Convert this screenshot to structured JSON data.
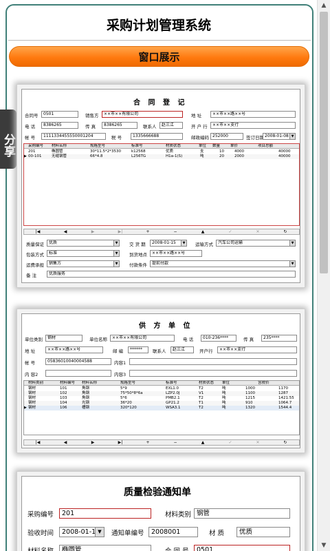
{
  "header": {
    "title": "采购计划管理系统",
    "banner": "窗口展示"
  },
  "share_tab": "分享",
  "contract": {
    "title": "合 同 登 记",
    "fields": {
      "contract_no_label": "合同号",
      "contract_no": "0501",
      "seller_label": "销售方",
      "seller": "××市××有限公司",
      "address_label": "地 址",
      "address": "××市××路××号",
      "phone_label": "电 话",
      "phone": "8386265",
      "fax_label": "传 真",
      "fax": "8386265",
      "contact_label": "联系人",
      "contact": "赵三江",
      "bank_label": "开 户 行",
      "bank": "××市××支行",
      "account_label": "帐 号",
      "account": "1111334455550001204",
      "tax_label": "税 号",
      "tax": "1335666688",
      "postcode_label": "邮政编码",
      "postcode": "252000",
      "sign_date_label": "签订日期",
      "sign_date": "2008-01-08"
    },
    "grid": {
      "headers": [
        "采购编号",
        "材料名称",
        "规格型号",
        "标准号",
        "材质状态",
        "单位",
        "数量",
        "单价",
        "项目总额"
      ],
      "rows": [
        [
          "201",
          "椭圆管",
          "30*11.5*2*3530",
          "k12568",
          "优质",
          "支",
          "10",
          "4000",
          "40000"
        ],
        [
          "00-101",
          "无缝钢管",
          "66*4.8",
          "L256TG",
          "H1a-1(S)",
          "吨",
          "20",
          "2000",
          "40000"
        ]
      ]
    },
    "nav": [
      "|◀",
      "◀",
      "▶",
      "▶|",
      "+",
      "−",
      "▲",
      "✓",
      "✕",
      "↻"
    ],
    "bottom": {
      "quality_label": "质量保证",
      "quality": "优质",
      "delivery_label": "交 货 期",
      "delivery": "2008-01-15",
      "transport_label": "运输方式",
      "transport": "汽车公司运输",
      "packing_label": "包装方式",
      "packing": "标准",
      "arrive_label": "到货地点",
      "arrive": "××市××路××号",
      "freight_label": "运费承担",
      "freight": "销售方",
      "payment_label": "付款条件",
      "payment": "提前付款",
      "remark_label": "备 注",
      "remark": "优质服务"
    }
  },
  "supplier": {
    "title": "供 方 单 位",
    "fields": {
      "category_label": "单位类别",
      "category": "钢材",
      "name_label": "单位名称",
      "name": "××市××有限公司",
      "phone_label": "电 话",
      "phone": "010-236****",
      "fax_label": "传 真",
      "fax": "235****",
      "address_label": "地 址",
      "address": "××市××路××号",
      "post_label": "邮 编",
      "post": "******",
      "contact_label": "联系人",
      "contact": "赵三江",
      "bank_label": "开户行",
      "bank": "××市××支行",
      "account_label": "帐 号",
      "account": "05836010040004588",
      "content1_label": "内容1",
      "content1": "",
      "content2_label": "内 容2",
      "content2": "",
      "content3_label": "内容3",
      "content3": ""
    },
    "grid": {
      "headers": [
        "材料类别",
        "材料编号",
        "材料名称",
        "规格型号",
        "标准号",
        "材质状态",
        "单位",
        "含税价"
      ],
      "rows": [
        [
          "钢材",
          "101",
          "角钢",
          "5*9",
          "EXL1.0",
          "T2",
          "吨",
          "1000",
          "1170"
        ],
        [
          "钢材",
          "102",
          "角钢",
          "75*50*8*6a",
          "LZP2.0J",
          "V1",
          "吨",
          "1100",
          "1287"
        ],
        [
          "钢材",
          "103",
          "角钢",
          "5*6",
          "PMB2.1",
          "T2",
          "吨",
          "1215",
          "1421.55"
        ],
        [
          "钢材",
          "104",
          "光钢",
          "36*20",
          "GP21.2",
          "T1",
          "吨",
          "910",
          "1064.7"
        ],
        [
          "钢材",
          "106",
          "槽钢",
          "320*120",
          "WSA3.1",
          "T2",
          "吨",
          "1320",
          "1544.4"
        ]
      ]
    },
    "nav": [
      "|◀",
      "◀",
      "▶",
      "▶|",
      "+",
      "−",
      "▲",
      "✓",
      "✕",
      "↻"
    ]
  },
  "inspection": {
    "title": "质量检验通知单",
    "purchase_no_label": "采购编号",
    "purchase_no": "201",
    "material_type_label": "材料类别",
    "material_type": "钢管",
    "check_time_label": "验收时间",
    "check_time": "2008-01-14",
    "notice_no_label": "通知单编号",
    "notice_no": "2008001",
    "texture_label": "材 质",
    "texture": "优质",
    "material_name_label": "材料名称",
    "material_name": "椭圆管",
    "contract_no_label": "合 同 号",
    "contract_no": "0501"
  },
  "colors": {
    "frame": "#3f7f78",
    "banner": "#ff7a10",
    "share": "#3b3b3b"
  }
}
